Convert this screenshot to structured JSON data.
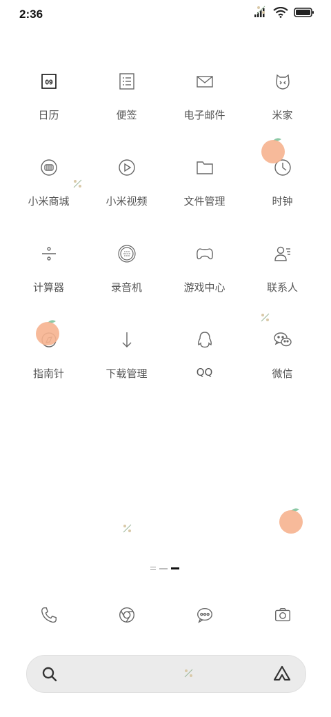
{
  "status_bar": {
    "time": "2:36"
  },
  "apps": [
    {
      "label": "日历",
      "icon": "calendar-icon",
      "date": "09"
    },
    {
      "label": "便签",
      "icon": "notes-icon"
    },
    {
      "label": "电子邮件",
      "icon": "mail-icon"
    },
    {
      "label": "米家",
      "icon": "mijia-icon"
    },
    {
      "label": "小米商城",
      "icon": "mi-store-icon"
    },
    {
      "label": "小米视频",
      "icon": "video-play-icon"
    },
    {
      "label": "文件管理",
      "icon": "folder-icon"
    },
    {
      "label": "时钟",
      "icon": "clock-icon"
    },
    {
      "label": "计算器",
      "icon": "calculator-icon"
    },
    {
      "label": "录音机",
      "icon": "recorder-icon"
    },
    {
      "label": "游戏中心",
      "icon": "gamepad-icon"
    },
    {
      "label": "联系人",
      "icon": "contacts-icon"
    },
    {
      "label": "指南针",
      "icon": "compass-icon"
    },
    {
      "label": "下载管理",
      "icon": "download-icon"
    },
    {
      "label": "QQ",
      "icon": "qq-penguin-icon"
    },
    {
      "label": "微信",
      "icon": "wechat-icon"
    }
  ],
  "dock": [
    "phone-icon",
    "browser-icon",
    "messages-icon",
    "camera-icon"
  ],
  "search_bar": {
    "left_icon": "search-icon",
    "right_icon": "assistant-icon"
  },
  "colors": {
    "icon_stroke": "#666666",
    "peach": "#f6b28f",
    "leaf": "#8cc9a6"
  }
}
